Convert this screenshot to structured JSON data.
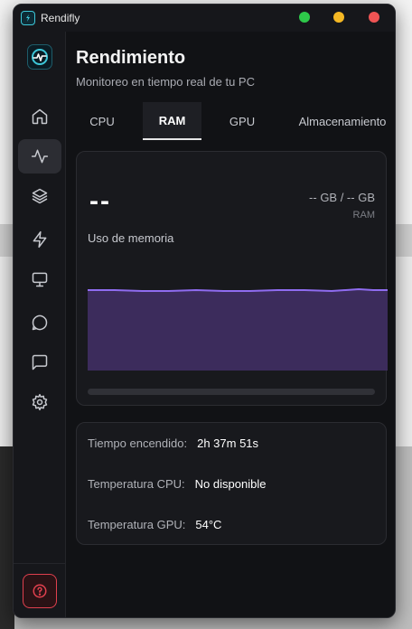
{
  "window": {
    "title": "Rendifly"
  },
  "page": {
    "title": "Rendimiento",
    "subtitle": "Monitoreo en tiempo real de tu PC"
  },
  "sidebar": {
    "items": [
      {
        "name": "home",
        "icon": "home-icon",
        "active": false
      },
      {
        "name": "performance",
        "icon": "activity-icon",
        "active": true
      },
      {
        "name": "layers",
        "icon": "layers-icon",
        "active": false
      },
      {
        "name": "boost",
        "icon": "zap-icon",
        "active": false
      },
      {
        "name": "monitor",
        "icon": "monitor-icon",
        "active": false
      },
      {
        "name": "chat",
        "icon": "chat-circle-icon",
        "active": false
      },
      {
        "name": "messages",
        "icon": "message-square-icon",
        "active": false
      },
      {
        "name": "settings",
        "icon": "gear-icon",
        "active": false
      }
    ],
    "help_icon": "help-circle-icon"
  },
  "tabs": [
    {
      "label": "CPU",
      "active": false
    },
    {
      "label": "RAM",
      "active": true
    },
    {
      "label": "GPU",
      "active": false
    },
    {
      "label": "Almacenamiento",
      "active": false
    }
  ],
  "ram": {
    "value": "--",
    "gb_text": "-- GB / -- GB",
    "unit_label": "RAM",
    "usage_label": "Uso de memoria",
    "progress": 0
  },
  "info": {
    "rows": [
      {
        "label": "Tiempo encendido:",
        "value": "2h 37m 51s"
      },
      {
        "label": "Temperatura CPU:",
        "value": "No disponible"
      },
      {
        "label": "Temperatura GPU:",
        "value": "54°C"
      }
    ]
  },
  "colors": {
    "accent": "#7d5ee6",
    "chart_fill": "#3c2c5c",
    "danger": "#e0404e",
    "background": "#111215"
  }
}
